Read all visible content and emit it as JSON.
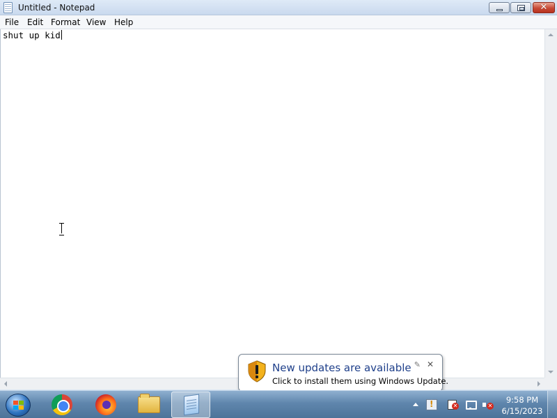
{
  "window": {
    "title": "Untitled - Notepad",
    "close_glyph": "✕"
  },
  "menu": {
    "items": [
      "File",
      "Edit",
      "Format",
      "View",
      "Help"
    ]
  },
  "editor": {
    "text": "shut up kid"
  },
  "notification": {
    "title": "New updates are available",
    "body": "Click to install them using Windows Update.",
    "close_glyph": "✕",
    "settings_glyph": "✎"
  },
  "taskbar": {
    "pinned": [
      "chrome-icon",
      "firefox-icon",
      "folder-icon",
      "notepad-icon"
    ],
    "active_app": "notepad-icon"
  },
  "tray": {
    "time": "9:58 PM",
    "date": "6/15/2023"
  },
  "colors": {
    "titlebar": "#c9d9ee",
    "taskbar": "#5f86ad",
    "notification_title": "#1e3f8a",
    "close_button": "#c74a36"
  }
}
